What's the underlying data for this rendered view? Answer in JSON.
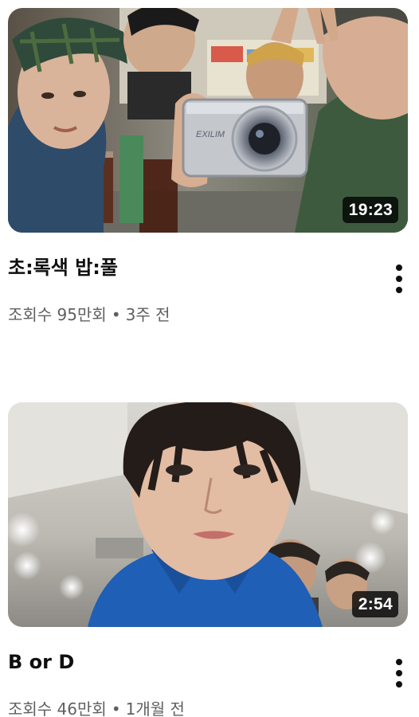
{
  "videos": [
    {
      "title": "초:록색 밥:풀",
      "views": "조회수 95만회",
      "separator": "•",
      "age": "3주 전",
      "duration": "19:23",
      "thumbnail": "group selfie at a restaurant table, one person holding a silver digital camera, drinks on table",
      "camera_brand": "EXILIM"
    },
    {
      "title": "B or D",
      "views": "조회수 46만회",
      "separator": "•",
      "age": "1개월 전",
      "duration": "2:54",
      "thumbnail": "close-up selfie of a person in a blue jacket with two people behind under ceiling lights"
    }
  ],
  "more_icon": "vertical-ellipsis-icon",
  "colors": {
    "title": "#0f0f0f",
    "meta": "#606060",
    "duration_bg": "#000000cc"
  }
}
